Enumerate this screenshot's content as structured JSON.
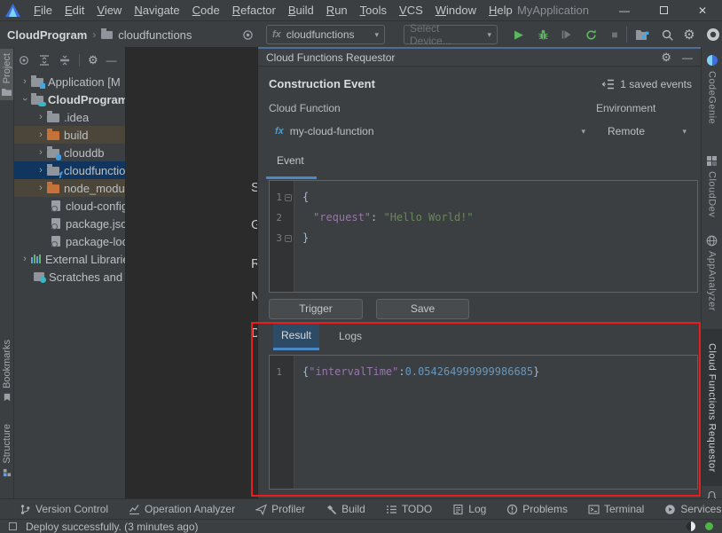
{
  "window": {
    "title": "MyApplication",
    "menu": [
      "File",
      "Edit",
      "View",
      "Navigate",
      "Code",
      "Refactor",
      "Build",
      "Run",
      "Tools",
      "VCS",
      "Window",
      "Help"
    ],
    "controls": {
      "minimize": "—",
      "close": "✕"
    }
  },
  "toolbar": {
    "breadcrumb": {
      "project": "CloudProgram",
      "separator": "›",
      "module": "cloudfunctions"
    },
    "run_config": {
      "prefix": "fx",
      "value": "cloudfunctions"
    },
    "device_select": {
      "placeholder": "Select Device..."
    }
  },
  "left_stripe": {
    "project": "Project",
    "bookmarks": "Bookmarks",
    "structure": "Structure"
  },
  "project_tree": {
    "items": [
      {
        "label": "Application [M"
      },
      {
        "label": "CloudProgram"
      },
      {
        "label": ".idea"
      },
      {
        "label": "build"
      },
      {
        "label": "clouddb"
      },
      {
        "label": "cloudfunctions"
      },
      {
        "label": "node_modules"
      },
      {
        "label": "cloud-config"
      },
      {
        "label": "package.json"
      },
      {
        "label": "package-lock"
      },
      {
        "label": "External Libraries"
      },
      {
        "label": "Scratches and"
      }
    ]
  },
  "editor_background": {
    "letters": [
      "S",
      "G",
      "R",
      "N",
      "D"
    ]
  },
  "panel": {
    "title": "Cloud Functions Requestor",
    "section_title": "Construction Event",
    "saved_events": "1 saved events",
    "cloud_function_label": "Cloud Function",
    "environment_label": "Environment",
    "function_combo": {
      "prefix": "fx",
      "value": "my-cloud-function"
    },
    "environment_combo": {
      "value": "Remote"
    },
    "event_tab": "Event",
    "event_editor": {
      "line_numbers": [
        "1",
        "2",
        "3"
      ],
      "line1": "{",
      "line2": {
        "key": "\"request\"",
        "separator": ": ",
        "value": "\"Hello World!\""
      },
      "line3": "}"
    },
    "trigger_button": "Trigger",
    "save_button": "Save",
    "result_tabs": {
      "result": "Result",
      "logs": "Logs"
    },
    "result_editor": {
      "line_number": "1",
      "open_brace": "{",
      "key": "\"intervalTime\"",
      "separator": ":",
      "value": "0.054264999999986685",
      "close_brace": "}"
    }
  },
  "right_stripe": {
    "tabs": [
      "CodeGenie",
      "CloudDev",
      "AppAnalyzer",
      "Cloud Functions Requestor"
    ]
  },
  "bottom_bar": {
    "items": [
      "Version Control",
      "Operation Analyzer",
      "Profiler",
      "Build",
      "TODO",
      "Log",
      "Problems",
      "Terminal",
      "Services"
    ]
  },
  "status_bar": {
    "message": "Deploy successfully. (3 minutes ago)"
  },
  "icons_text": {
    "gear": "⚙",
    "minus": "—",
    "caret": "▾",
    "play": "▶",
    "stop": "■",
    "chevron": "›"
  },
  "colors": {
    "accent_blue": "#4a88c7",
    "selection_blue": "#10365f",
    "excluded_brown": "#4b4639",
    "json_key": "#9876aa",
    "json_string": "#6a8759",
    "json_number": "#6897bb",
    "run_green": "#57a64a",
    "annotation_red": "#ec1c1c"
  }
}
